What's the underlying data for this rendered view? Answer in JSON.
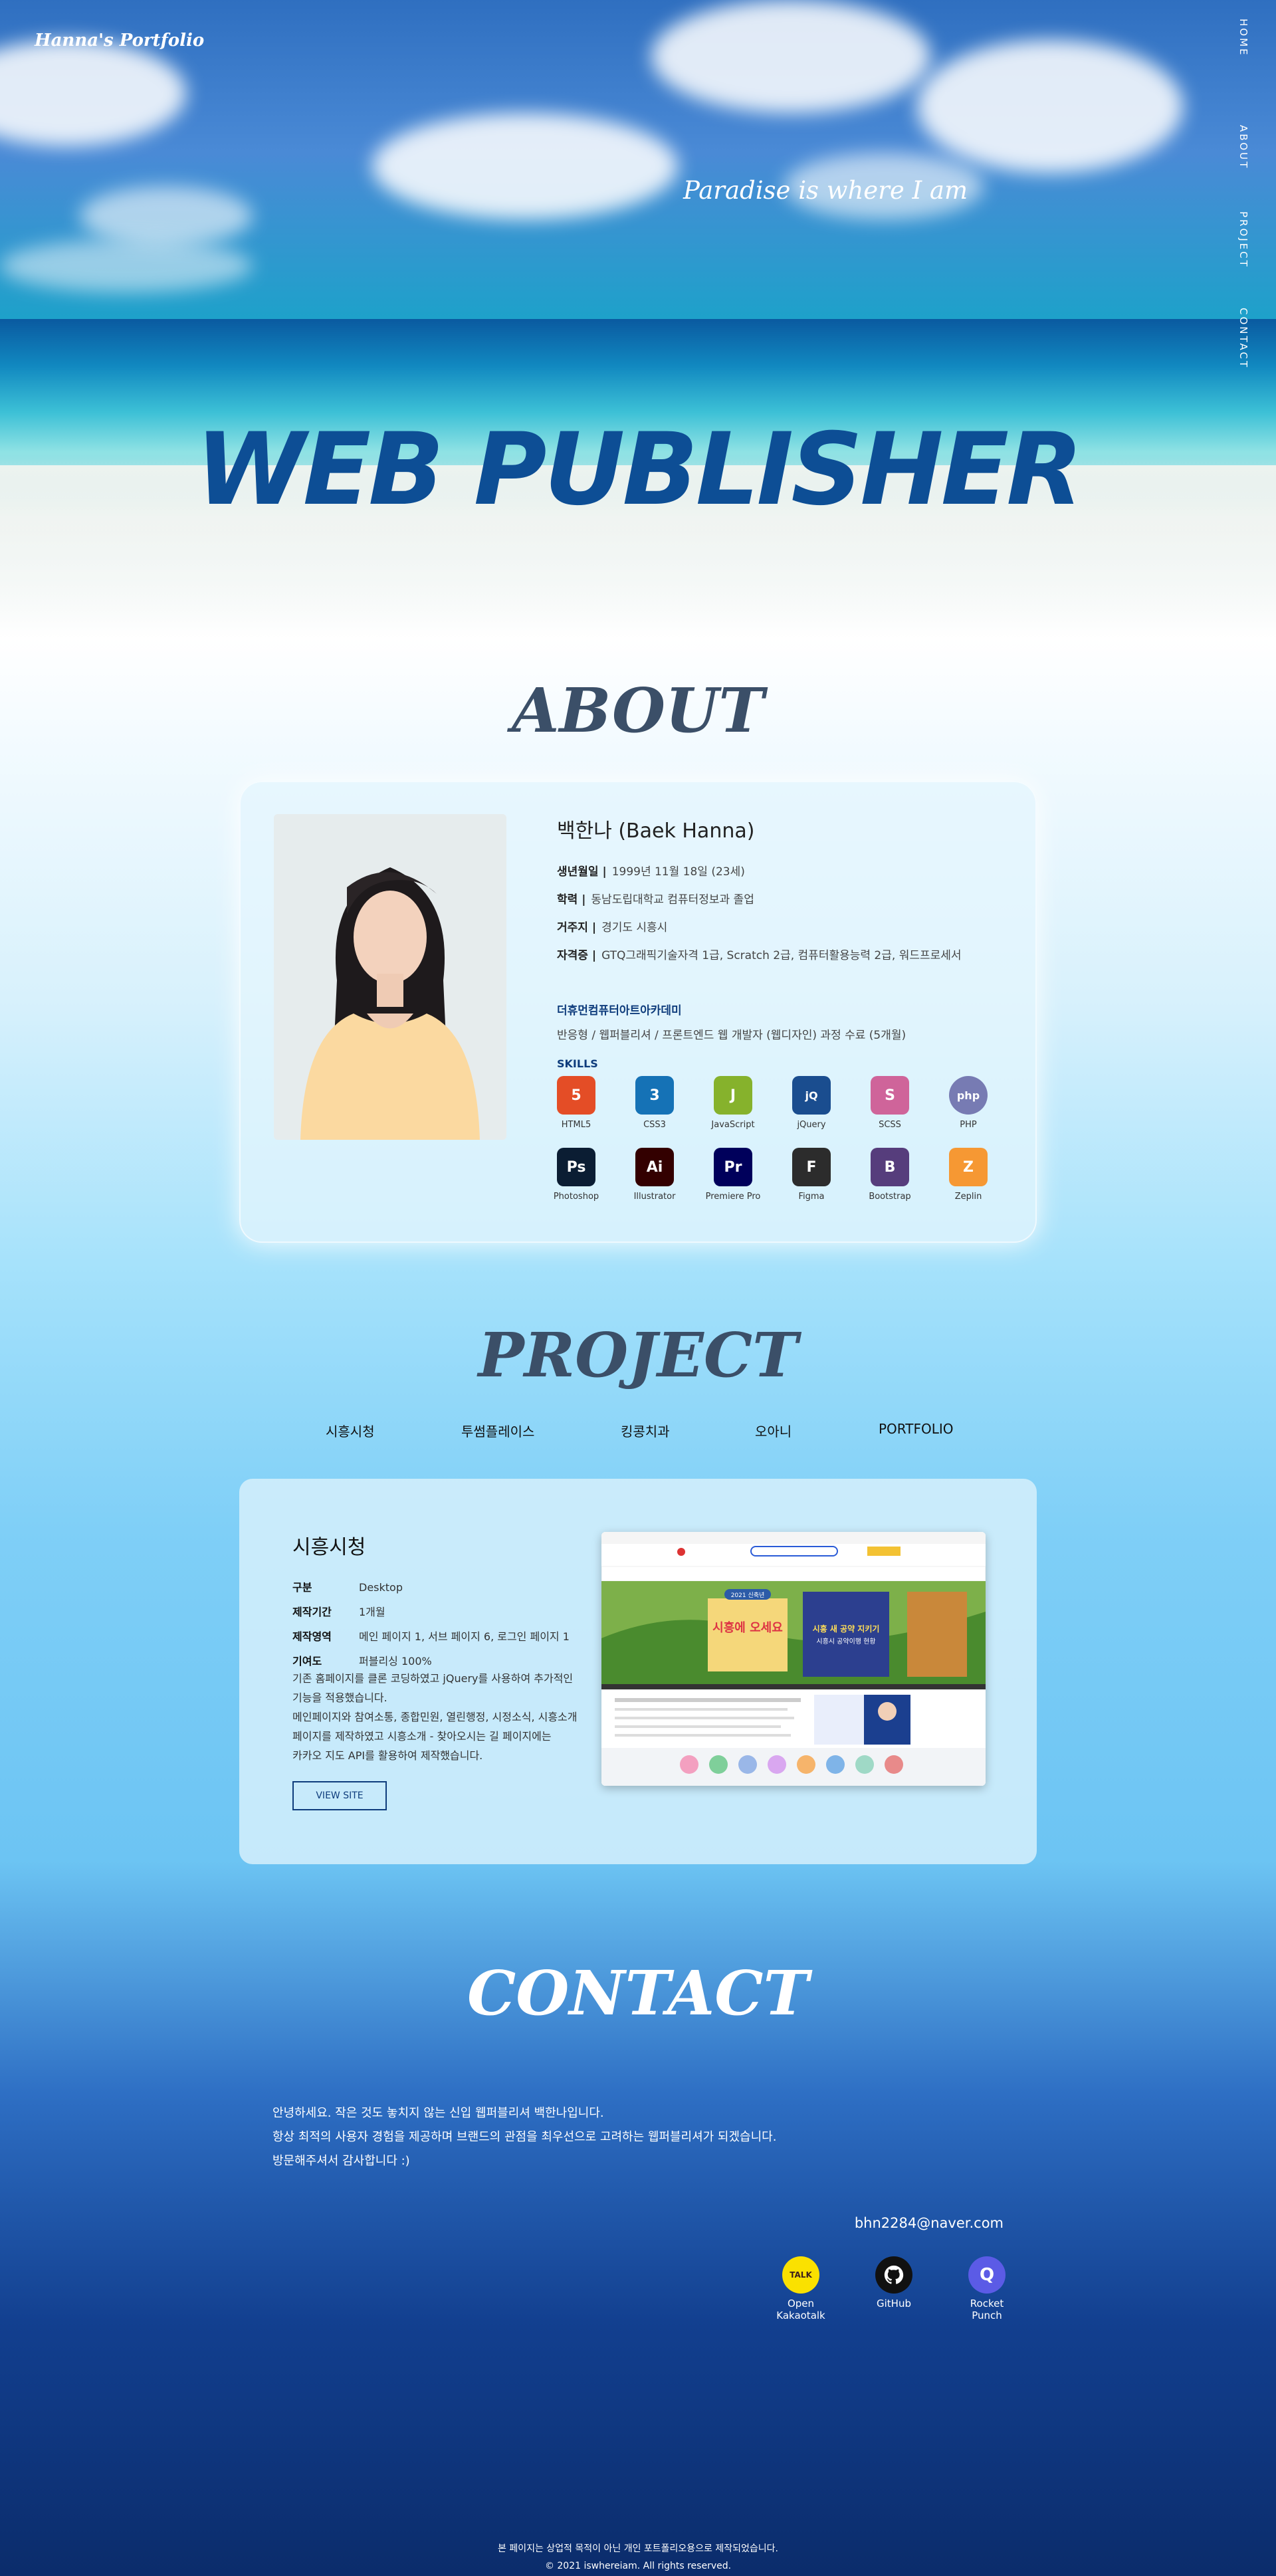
{
  "brand": "Hanna's Portfolio",
  "side_nav": [
    "HOME",
    "ABOUT",
    "PROJECT",
    "CONTACT"
  ],
  "hero": {
    "tagline": "Paradise is where I am",
    "title": "WEB PUBLISHER"
  },
  "about": {
    "section_title": "ABOUT",
    "name": "백한나 (Baek Hanna)",
    "info": [
      {
        "label": "생년월일 |",
        "value": "1999년 11월 18일 (23세)"
      },
      {
        "label": "학력 |",
        "value": "동남도립대학교 컴퓨터정보과 졸업"
      },
      {
        "label": "거주지 |",
        "value": "경기도 시흥시"
      },
      {
        "label": "자격증 |",
        "value": "GTQ그래픽기술자격 1급, Scratch 2급, 컴퓨터활용능력 2급, 워드프로세서"
      }
    ],
    "academy_title": "더휴먼컴퓨터아트아카데미",
    "academy_desc": "반응형 / 웹퍼블리셔 / 프론트엔드 웹 개발자 (웹디자인) 과정 수료 (5개월)",
    "skills_label": "SKILLS",
    "skills": [
      {
        "name": "HTML5",
        "icon": "html5-icon",
        "glyph": "5",
        "color": "#e44d26"
      },
      {
        "name": "CSS3",
        "icon": "css3-icon",
        "glyph": "3",
        "color": "#1572b6"
      },
      {
        "name": "JavaScript",
        "icon": "javascript-icon",
        "glyph": "J",
        "color": "#86b22c"
      },
      {
        "name": "jQuery",
        "icon": "jquery-icon",
        "glyph": "jQ",
        "color": "#1a4d8f"
      },
      {
        "name": "SCSS",
        "icon": "sass-icon",
        "glyph": "S",
        "color": "#cf649a"
      },
      {
        "name": "PHP",
        "icon": "php-icon",
        "glyph": "php",
        "color": "#777bb3"
      },
      {
        "name": "Photoshop",
        "icon": "photoshop-icon",
        "glyph": "Ps",
        "color": "#0b1d33"
      },
      {
        "name": "Illustrator",
        "icon": "illustrator-icon",
        "glyph": "Ai",
        "color": "#330000"
      },
      {
        "name": "Premiere Pro",
        "icon": "premiere-pro-icon",
        "glyph": "Pr",
        "color": "#00005b"
      },
      {
        "name": "Figma",
        "icon": "figma-icon",
        "glyph": "F",
        "color": "#2c2c2c"
      },
      {
        "name": "Bootstrap",
        "icon": "bootstrap-icon",
        "glyph": "B",
        "color": "#563d7c"
      },
      {
        "name": "Zeplin",
        "icon": "zeplin-icon",
        "glyph": "Z",
        "color": "#f69833"
      }
    ]
  },
  "project": {
    "section_title": "PROJECT",
    "tabs": [
      "시흥시청",
      "투썸플레이스",
      "킹콩치과",
      "오아니",
      "PORTFOLIO"
    ],
    "active_tab": "시흥시청",
    "title": "시흥시청",
    "meta": [
      {
        "label": "구분",
        "value": "Desktop"
      },
      {
        "label": "제작기간",
        "value": "1개월"
      },
      {
        "label": "제작영역",
        "value": "메인 페이지 1, 서브 페이지 6, 로그인 페이지 1"
      },
      {
        "label": "기여도",
        "value": "퍼블리싱 100%"
      }
    ],
    "description": [
      "기존 홈페이지를 클론 코딩하였고 jQuery를 사용하여 추가적인",
      "기능을 적용했습니다.",
      "메인페이지와 참여소통, 종합민원, 열린행정, 시정소식, 시흥소개",
      "페이지를 제작하였고 시흥소개 - 찾아오시는 길 페이지에는",
      "카카오 지도 API를 활용하여 제작했습니다."
    ],
    "view_button": "VIEW SITE",
    "screenshot": {
      "banner_title": "시흥에 오세요",
      "banner_badge": "2021 신축년",
      "news_title": "시흥 새 공약 지키기",
      "news_sub": "시흥시 공약이행 현황"
    }
  },
  "contact": {
    "section_title": "CONTACT",
    "lines": [
      "안녕하세요. 작은 것도 놓치지 않는 신입 웹퍼블리셔 백한나입니다.",
      "항상 최적의 사용자 경험을 제공하며 브랜드의 관점을 최우선으로 고려하는 웹퍼블리셔가 되겠습니다.",
      "방문해주셔서 감사합니다 :)"
    ],
    "email": "bhn2284@naver.com",
    "socials": [
      {
        "label_1": "Open",
        "label_2": "Kakaotalk",
        "icon": "kakaotalk-icon",
        "glyph": "TALK",
        "color": "#fae100"
      },
      {
        "label_1": "GitHub",
        "label_2": "",
        "icon": "github-icon",
        "glyph": "●",
        "color": "#111111"
      },
      {
        "label_1": "Rocket",
        "label_2": "Punch",
        "icon": "rocketpunch-icon",
        "glyph": "Q",
        "color": "#5b5be6"
      }
    ]
  },
  "footer": {
    "line1": "본 페이지는 상업적 목적이 아닌 개인 포트폴리오용으로 제작되었습니다.",
    "line2": "© 2021 iswhereiam. All rights reserved."
  }
}
